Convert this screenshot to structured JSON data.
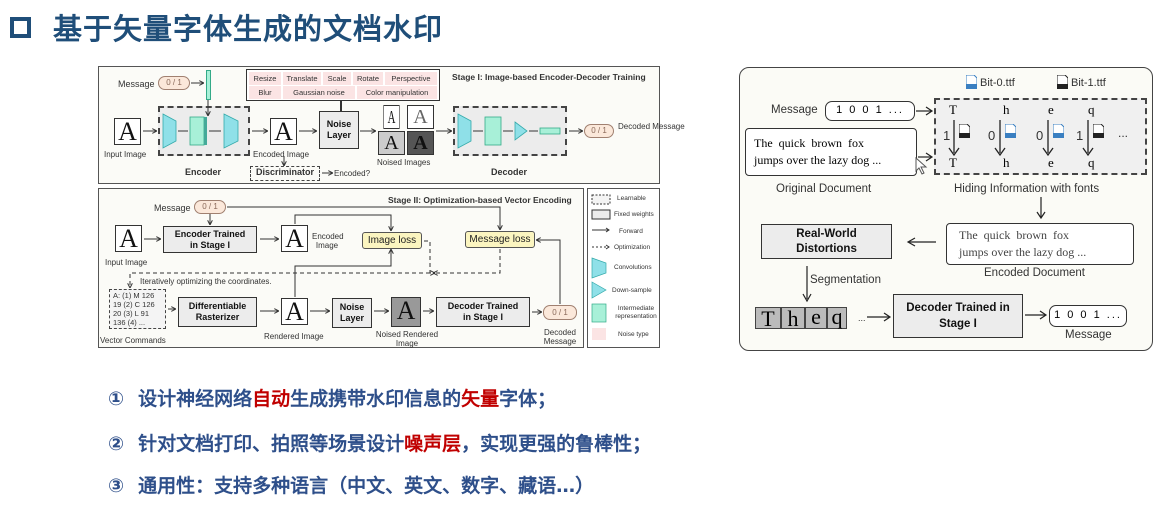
{
  "title": "基于矢量字体生成的文档水印",
  "stage1": {
    "title": "Stage I:  Image-based Encoder-Decoder Training",
    "message_label": "Message",
    "message_value": "0 / 1",
    "input_image_label": "Input Image",
    "encoder_label": "Encoder",
    "encoded_image_label": "Encoded Image",
    "discriminator_label": "Discriminator",
    "encoded_q": "Encoded?",
    "noise_layer_label": "Noise Layer",
    "noised_images_label": "Noised Images",
    "decoder_label": "Decoder",
    "decoded_value": "0 / 1",
    "decoded_label": "Decoded Message",
    "noise_types": [
      "Resize",
      "Translate",
      "Scale",
      "Rotate",
      "Perspective",
      "Blur",
      "Gaussian noise",
      "Color manipulation"
    ],
    "glyph": "A"
  },
  "stage2": {
    "title": "Stage II:  Optimization-based Vector Encoding",
    "message_label": "Message",
    "message_value": "0 / 1",
    "input_image_label": "Input Image",
    "encoder_label": "Encoder Trained in Stage I",
    "encoded_image_label": "Encoded Image",
    "image_loss": "Image loss",
    "message_loss": "Message loss",
    "iter_note": "Iteratively optimizing the coordinates.",
    "vector_commands": [
      "A: (1) M 126",
      "19 (2) C 126",
      "20 (3) L 91",
      "136 (4) ..."
    ],
    "vector_commands_label": "Vector Commands",
    "rasterizer_label": "Differentiable Rasterizer",
    "rendered_image_label": "Rendered Image",
    "noise_layer_label": "Noise Layer",
    "noised_rendered_label": "Noised Rendered Image",
    "decoder_label": "Decoder Trained in Stage I",
    "decoded_value": "0 / 1",
    "decoded_label": "Decoded Message"
  },
  "legend": [
    {
      "icon": "dashed-box",
      "label": "Learnable"
    },
    {
      "icon": "solid-box",
      "label": "Fixed weights"
    },
    {
      "icon": "solid-arrow",
      "label": "Forward"
    },
    {
      "icon": "dashed-arrow",
      "label": "Optimization"
    },
    {
      "icon": "trapezoid",
      "label": "Convolutions"
    },
    {
      "icon": "triangle",
      "label": "Down-sample"
    },
    {
      "icon": "green-box",
      "label": "Intermediate representation"
    },
    {
      "icon": "pink-box",
      "label": "Noise type"
    }
  ],
  "right": {
    "bit0": "Bit-0.ttf",
    "bit1": "Bit-1.ttf",
    "message_label": "Message",
    "message_value": "1 0 0 1 ...",
    "original_text_1": "The  quick  brown  fox",
    "original_text_2": "jumps over the lazy dog ...",
    "original_label": "Original Document",
    "chars": [
      "T",
      "h",
      "e",
      "q"
    ],
    "bits": [
      "1",
      "0",
      "0",
      "1"
    ],
    "ellipsis": "...",
    "hiding_label": "Hiding Information with fonts",
    "distortions_label": "Real-World Distortions",
    "encoded_text_1": "The  quick  brown  fox",
    "encoded_text_2": "jumps over the lazy dog ...",
    "encoded_label": "Encoded Document",
    "segmentation_label": "Segmentation",
    "seg_chars": [
      "T",
      "h",
      "e",
      "q"
    ],
    "decoder_label": "Decoder Trained in Stage I",
    "out_value": "1 0 0 1 ...",
    "out_label": "Message"
  },
  "bullets": [
    {
      "num": "①",
      "parts": [
        {
          "t": "设计神经网络",
          "red": false
        },
        {
          "t": "自动",
          "red": true
        },
        {
          "t": "生成携带水印信息的",
          "red": false
        },
        {
          "t": "矢量",
          "red": true
        },
        {
          "t": "字体；",
          "red": false
        }
      ]
    },
    {
      "num": "②",
      "parts": [
        {
          "t": "针对文档打印、拍照等场景设计",
          "red": false
        },
        {
          "t": "噪声层",
          "red": true
        },
        {
          "t": "，实现更强的鲁棒性；",
          "red": false
        }
      ]
    },
    {
      "num": "③",
      "parts": [
        {
          "t": "通用性：支持多种语言（中文、英文、数字、藏语…）",
          "red": false
        }
      ]
    }
  ],
  "colors": {
    "title": "#1f4e79",
    "bullet": "#2e4f8a",
    "highlight": "#c00000",
    "conv": "#8fe0e8",
    "inter": "#a8f0d8",
    "noise": "#fbe4e4"
  }
}
